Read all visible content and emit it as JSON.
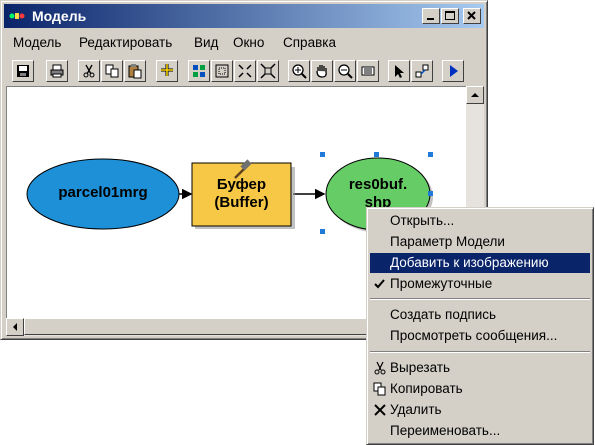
{
  "window": {
    "title": "Модель",
    "controls": [
      "minimize-icon",
      "maximize-icon",
      "close-icon"
    ]
  },
  "menubar": {
    "items": [
      "Модель",
      "Редактировать",
      "Вид",
      "Окно",
      "Справка"
    ]
  },
  "toolbar": {
    "buttons": [
      "save-icon",
      "print-icon",
      "cut-icon",
      "copy-icon",
      "paste-icon",
      "add-data-icon",
      "grid-icon",
      "full-extent-icon",
      "zoom-in-fixed-icon",
      "zoom-out-fixed-icon",
      "zoom-in-icon",
      "pan-icon",
      "zoom-out-icon",
      "layout-icon",
      "select-pointer-icon",
      "connect-icon",
      "run-icon"
    ]
  },
  "model": {
    "input": {
      "label": "parcel01mrg",
      "color": "#1e90d8"
    },
    "tool": {
      "label": "Буфер\n(Buffer)",
      "color": "#f7c845"
    },
    "output": {
      "label": "res0buf.\nshp",
      "color": "#66cc66"
    }
  },
  "context_menu": {
    "items": [
      {
        "label": "Открыть...",
        "highlighted": false,
        "icon": ""
      },
      {
        "label": "Параметр Модели",
        "highlighted": false,
        "icon": ""
      },
      {
        "label": "Добавить к изображению",
        "highlighted": true,
        "icon": ""
      },
      {
        "label": "Промежуточные",
        "highlighted": false,
        "icon": "check-icon"
      },
      {
        "label": "Создать подпись",
        "highlighted": false,
        "icon": ""
      },
      {
        "label": "Просмотреть сообщения...",
        "highlighted": false,
        "icon": ""
      },
      {
        "label": "Вырезать",
        "highlighted": false,
        "icon": "cut-icon"
      },
      {
        "label": "Копировать",
        "highlighted": false,
        "icon": "copy-icon"
      },
      {
        "label": "Удалить",
        "highlighted": false,
        "icon": "delete-icon"
      },
      {
        "label": "Переименовать...",
        "highlighted": false,
        "icon": ""
      }
    ],
    "highlight_color": "#0a246a"
  }
}
